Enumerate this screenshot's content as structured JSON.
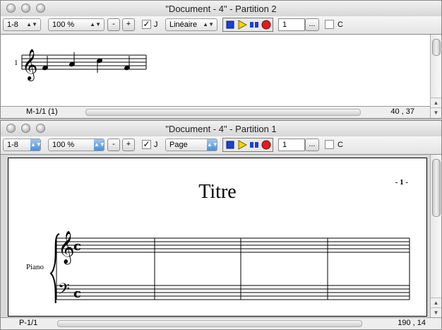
{
  "win_top": {
    "title": "\"Document - 4\" - Partition 2",
    "range_select": "1-8",
    "zoom_select": "100 %",
    "zoom_minus": "-",
    "zoom_plus": "+",
    "j_label": "J",
    "j_checked": true,
    "view_select": "Linéaire",
    "number_value": "1",
    "more_button": "...",
    "c_label": "C",
    "c_checked": false,
    "staff_number": "1",
    "status_left": "M-1/1 (1)",
    "status_right": "40 , 37"
  },
  "win_bottom": {
    "title": "\"Document - 4\" - Partition 1",
    "range_select": "1-8",
    "zoom_select": "100 %",
    "zoom_minus": "-",
    "zoom_plus": "+",
    "j_label": "J",
    "j_checked": true,
    "view_select": "Page",
    "number_value": "1",
    "more_button": "...",
    "c_label": "C",
    "c_checked": false,
    "score_title": "Titre",
    "page_number": "- 1 -",
    "instrument": "Piano",
    "status_left": "P-1/1",
    "status_right": "190 , 14"
  },
  "icons": {
    "stop": "stop-square-icon",
    "play": "play-triangle-icon",
    "step": "step-bars-icon",
    "record": "record-circle-icon"
  },
  "colors": {
    "stop": "#1a3fd6",
    "play": "#f2d500",
    "step": "#1a3fd6",
    "record": "#e21b1b",
    "select_arrow_blue": "#4a8fd8"
  }
}
